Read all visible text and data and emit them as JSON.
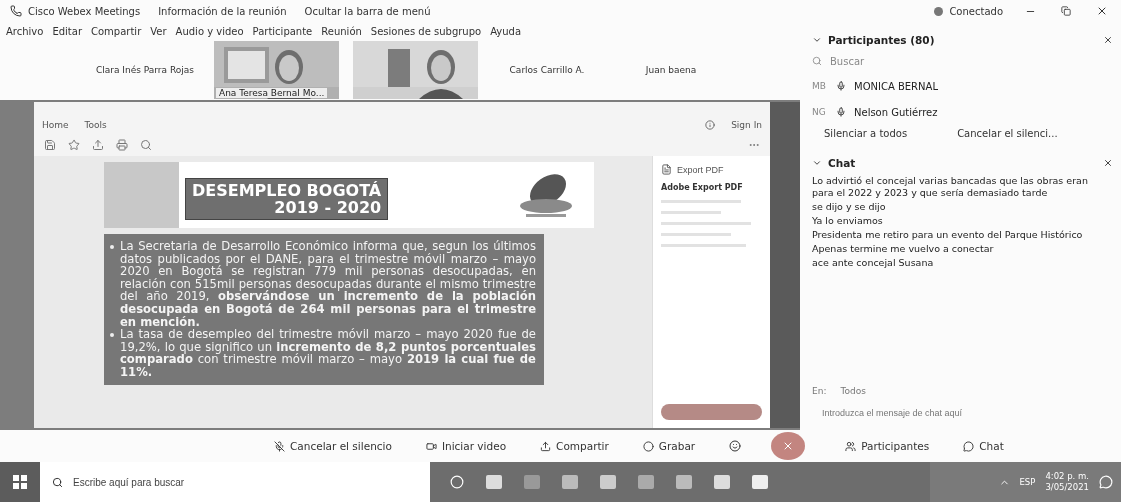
{
  "app": {
    "title": "Cisco Webex Meetings",
    "info": "Información de la reunión",
    "hide_menu": "Ocultar la barra de menú",
    "status": "Conectado"
  },
  "menu": [
    "Archivo",
    "Editar",
    "Compartir",
    "Ver",
    "Audio y video",
    "Participante",
    "Reunión",
    "Sesiones de subgrupo",
    "Ayuda"
  ],
  "videos": [
    {
      "kind": "name",
      "name": "Clara Inés Parra Rojas"
    },
    {
      "kind": "video",
      "name": "Ana Teresa Bernal Mo..."
    },
    {
      "kind": "video"
    },
    {
      "kind": "name",
      "name": "Carlos Carrillo A."
    },
    {
      "kind": "name",
      "name": "Juan baena"
    }
  ],
  "viewer": {
    "tabs": [
      "Home",
      "Tools"
    ],
    "sign_in": "Sign In",
    "export_button": "Export PDF",
    "export_title": "Adobe Export PDF"
  },
  "slide": {
    "title": "DESEMPLEO BOGOTÁ",
    "years": "2019 - 2020",
    "bullets": [
      "La Secretaria de Desarrollo Económico informa que, segun los últimos datos publicados por el DANE, para el trimestre móvil marzo – mayo 2020 en Bogotá se registran 779 mil personas desocupadas, en relación con 515mil personas desocupadas durante el mismo trimestre del año 2019, **observándose un incremento de la población desocupada en Bogotá de 264 mil personas para el trimestre en mención.**",
      "La tasa de desempleo del trimestre móvil marzo – mayo 2020 fue de 19,2%, lo que significo un **incremento de 8,2 puntos porcentuales comparado** con trimestre móvil marzo – mayo **2019 la cual fue de 11%.**"
    ]
  },
  "participants": {
    "title": "Participantes (80)",
    "search_placeholder": "Buscar",
    "people": [
      {
        "initials": "MB",
        "name": "MONICA BERNAL"
      },
      {
        "initials": "NG",
        "name": "Nelson Gutiérrez"
      }
    ],
    "actions": [
      "Silenciar a todos",
      "Cancelar el silenci..."
    ]
  },
  "chat": {
    "title": "Chat",
    "messages": [
      "Lo advirtió el concejal varias bancadas que las obras eran para el 2022 y 2023 y que sería demasiado tarde",
      "se dijo y se dijo",
      "Ya lo enviamos",
      "Presidenta me retiro para un evento del Parque Histórico",
      "Apenas termine me vuelvo a conectar",
      "ace ante concejal Susana"
    ],
    "to_label": "En:",
    "to_value": "Todos",
    "placeholder": "Introduzca el mensaje de chat aquí"
  },
  "controls": [
    {
      "kind": "mute",
      "label": "Cancelar el silencio"
    },
    {
      "kind": "video",
      "label": "Iniciar video"
    },
    {
      "kind": "share",
      "label": "Compartir"
    },
    {
      "kind": "record",
      "label": "Grabar"
    },
    {
      "kind": "reactions"
    },
    {
      "kind": "end"
    },
    {
      "kind": "participants",
      "label": "Participantes"
    },
    {
      "kind": "chat",
      "label": "Chat"
    }
  ],
  "taskbar": {
    "search_placeholder": "Escribe aquí para buscar",
    "language": "ESP",
    "time": "4:02 p. m.",
    "date": "3/05/2021"
  }
}
